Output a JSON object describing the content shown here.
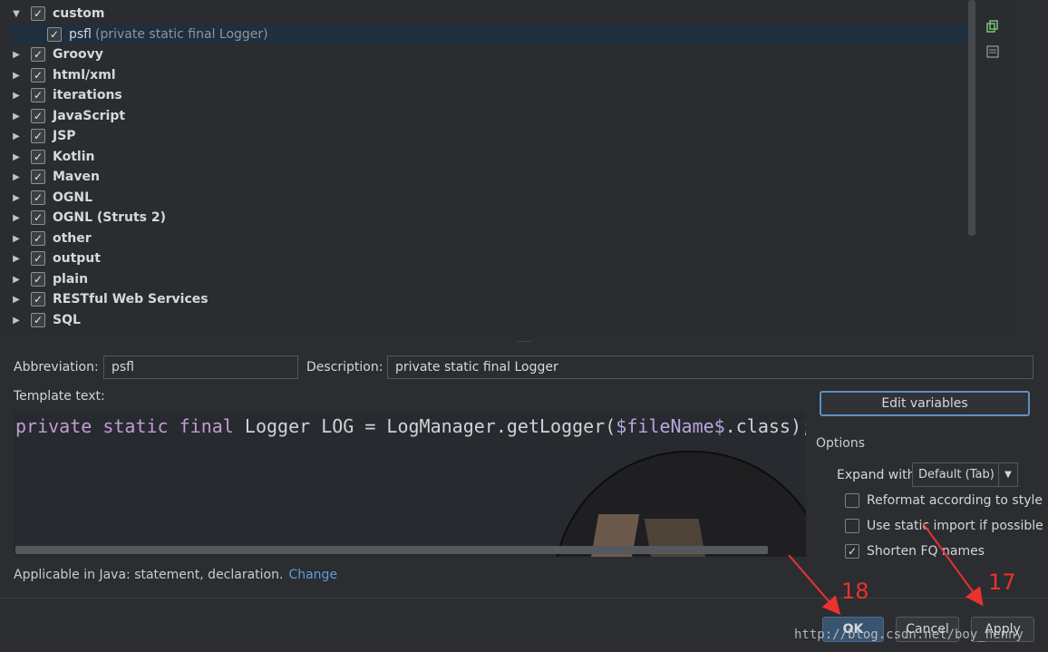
{
  "tree": {
    "groups": [
      {
        "label": "custom",
        "expanded": true,
        "checked": true
      },
      {
        "label": "Groovy",
        "expanded": false,
        "checked": true
      },
      {
        "label": "html/xml",
        "expanded": false,
        "checked": true
      },
      {
        "label": "iterations",
        "expanded": false,
        "checked": true
      },
      {
        "label": "JavaScript",
        "expanded": false,
        "checked": true
      },
      {
        "label": "JSP",
        "expanded": false,
        "checked": true
      },
      {
        "label": "Kotlin",
        "expanded": false,
        "checked": true
      },
      {
        "label": "Maven",
        "expanded": false,
        "checked": true
      },
      {
        "label": "OGNL",
        "expanded": false,
        "checked": true
      },
      {
        "label": "OGNL (Struts 2)",
        "expanded": false,
        "checked": true
      },
      {
        "label": "other",
        "expanded": false,
        "checked": true
      },
      {
        "label": "output",
        "expanded": false,
        "checked": true
      },
      {
        "label": "plain",
        "expanded": false,
        "checked": true
      },
      {
        "label": "RESTful Web Services",
        "expanded": false,
        "checked": true
      },
      {
        "label": "SQL",
        "expanded": false,
        "checked": true
      }
    ],
    "child": {
      "name": "psfl",
      "desc": "(private static final Logger)"
    }
  },
  "form": {
    "abbreviation_label": "Abbreviation:",
    "abbreviation_value": "psfl",
    "description_label": "Description:",
    "description_value": "private static final Logger",
    "template_label": "Template text:"
  },
  "code": {
    "kw1": "private",
    "kw2": "static",
    "kw3": "final",
    "plain1": " Logger LOG = LogManager.getLogger(",
    "var": "$fileName$",
    "plain2": ".class);"
  },
  "options": {
    "edit_variables": "Edit variables",
    "title": "Options",
    "expand_label": "Expand with",
    "expand_value": "Default (Tab)",
    "reformat": "Reformat according to style",
    "static_import": "Use static import if possible",
    "shorten": "Shorten FQ names"
  },
  "applicable": {
    "text": "Applicable in Java: statement, declaration.",
    "link": "Change"
  },
  "buttons": {
    "ok": "OK",
    "cancel": "Cancel",
    "apply": "Apply"
  },
  "annotations": {
    "a18": "18",
    "a17": "17"
  },
  "watermark": "http://blog.csdn.net/boy_henny",
  "colors": {
    "accent": "#5e8ec3",
    "link": "#5c9de1",
    "annotation": "#e8322f",
    "keyword": "#c39bd3"
  }
}
